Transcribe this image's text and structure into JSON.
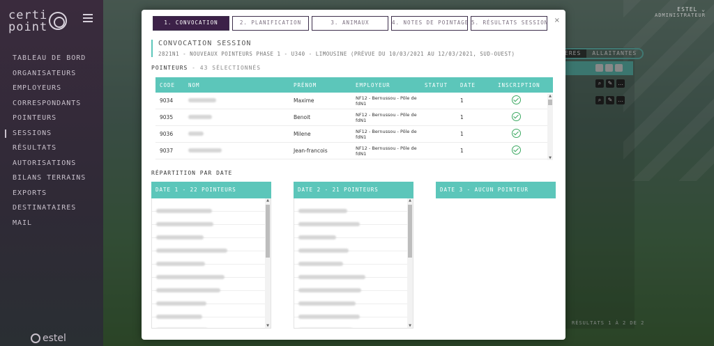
{
  "app": {
    "logo_text_1": "certi",
    "logo_text_2": "point",
    "footer_brand": "estel"
  },
  "user": {
    "name": "ESTEL ⌄",
    "role": "ADMINISTRATEUR"
  },
  "sidebar": {
    "items": [
      {
        "label": "TABLEAU DE BORD",
        "active": false
      },
      {
        "label": "ORGANISATEURS",
        "active": false
      },
      {
        "label": "EMPLOYEURS",
        "active": false
      },
      {
        "label": "CORRESPONDANTS",
        "active": false
      },
      {
        "label": "POINTEURS",
        "active": false
      },
      {
        "label": "SESSIONS",
        "active": true
      },
      {
        "label": "RÉSULTATS",
        "active": false
      },
      {
        "label": "AUTORISATIONS",
        "active": false
      },
      {
        "label": "BILANS TERRAINS",
        "active": false
      },
      {
        "label": "EXPORTS",
        "active": false
      },
      {
        "label": "DESTINATAIRES",
        "active": false
      },
      {
        "label": "MAIL",
        "active": false
      }
    ]
  },
  "background": {
    "tab_left": "ÈRES",
    "tab_right": "ALLAITANTES",
    "strip_label": "NT",
    "footer": "RÉSULTATS 1 À 2 DE 2"
  },
  "modal": {
    "close": "×",
    "steps": [
      {
        "label": "1. CONVOCATION",
        "active": true
      },
      {
        "label": "2. PLANIFICATION",
        "active": false
      },
      {
        "label": "3. ANIMAUX",
        "active": false
      },
      {
        "label": "4. NOTES DE POINTAGE",
        "active": false
      },
      {
        "label": "5. RÉSULTATS SESSION",
        "active": false
      }
    ],
    "title": "CONVOCATION SESSION",
    "subtitle": "2821N1 - NOUVEAUX POINTEURS PHASE 1 - U340 - LIMOUSINE (PRÉVUE DU 10/03/2021 AU 12/03/2021, SUD-OUEST)",
    "pointeurs_label": "POINTEURS",
    "pointeurs_count": " - 43 SÉLECTIONNÉS",
    "table": {
      "headers": [
        "CODE",
        "NOM",
        "PRÉNOM",
        "EMPLOYEUR",
        "STATUT",
        "DATE",
        "INSCRIPTION"
      ],
      "rows": [
        {
          "code": "9034",
          "prenom": "Maxime",
          "employeur": "NF12 - Bernussou - Pôle de fdN1",
          "statut": "",
          "date": "1",
          "inscrit": true
        },
        {
          "code": "9035",
          "prenom": "Benoit",
          "employeur": "NF12 - Bernussou - Pôle de fdN1",
          "statut": "",
          "date": "1",
          "inscrit": true
        },
        {
          "code": "9036",
          "prenom": "Milene",
          "employeur": "NF12 - Bernussou - Pôle de fdN1",
          "statut": "",
          "date": "1",
          "inscrit": true
        },
        {
          "code": "9037",
          "prenom": "Jean-francois",
          "employeur": "NF12 - Bernussou - Pôle de fdN1",
          "statut": "",
          "date": "1",
          "inscrit": true
        }
      ]
    },
    "repartition_label": "RÉPARTITION PAR DATE",
    "dates": [
      {
        "title": "DATE 1",
        "count": " - 22 POINTEURS"
      },
      {
        "title": "DATE 2",
        "count": " - 21 POINTEURS"
      },
      {
        "title": "DATE 3",
        "count": " - AUCUN POINTEUR"
      }
    ]
  }
}
